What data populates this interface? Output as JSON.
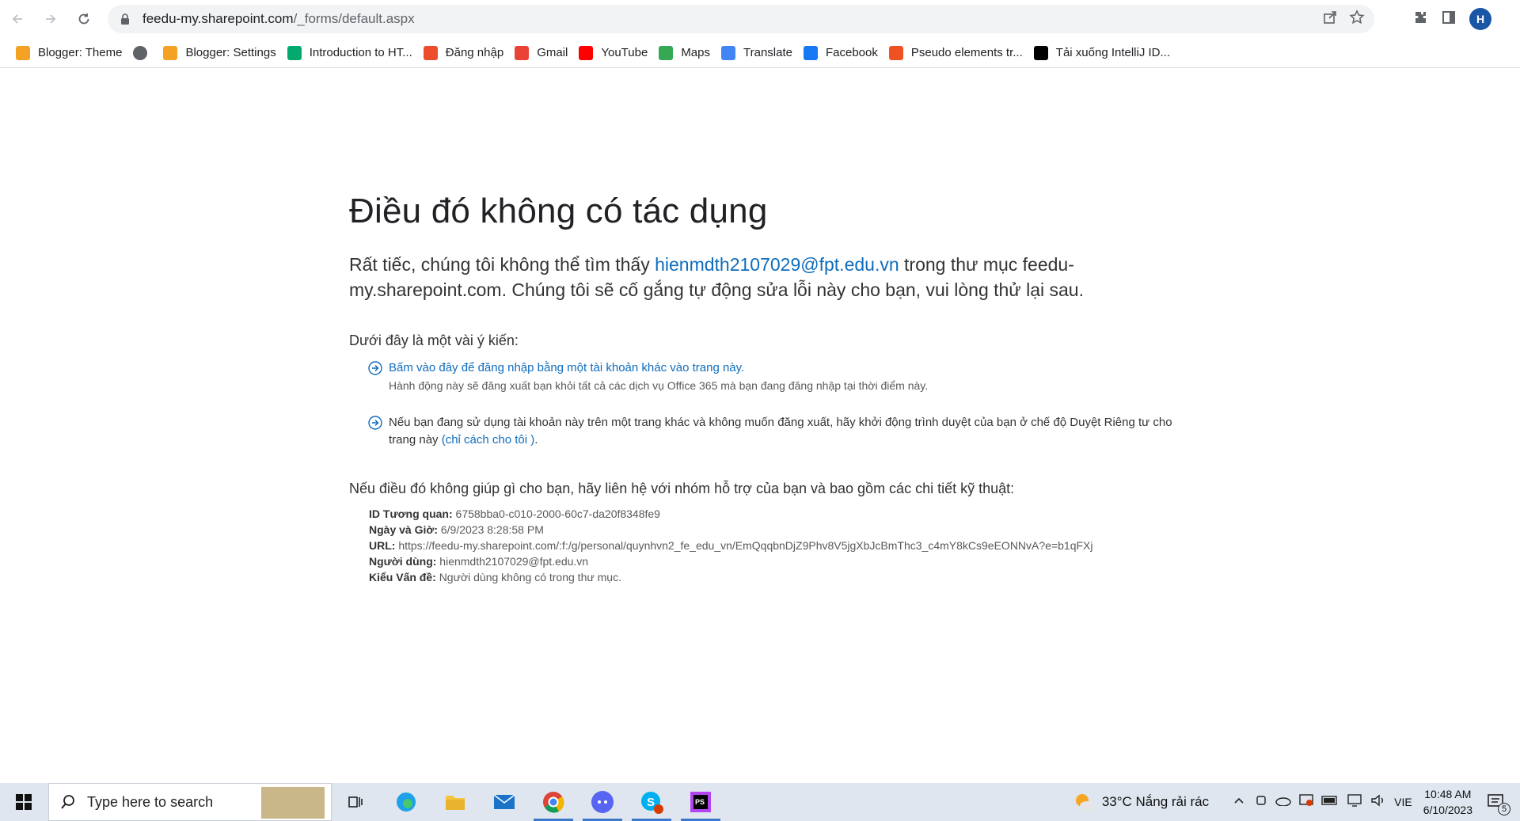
{
  "browser": {
    "url_host": "feedu-my.sharepoint.com",
    "url_path": "/_forms/default.aspx",
    "profile_initial": "H"
  },
  "bookmarks": [
    {
      "label": "Blogger: Theme",
      "icon": "blogger-icon",
      "color": "#f4a223"
    },
    {
      "label": "",
      "icon": "globe-icon",
      "color": "#5f6368"
    },
    {
      "label": "Blogger: Settings",
      "icon": "blogger-icon",
      "color": "#f4a223"
    },
    {
      "label": "Introduction to HT...",
      "icon": "w3schools-icon",
      "color": "#04aa6d"
    },
    {
      "label": "Đăng nhập",
      "icon": "shopee-icon",
      "color": "#ee4d2d"
    },
    {
      "label": "Gmail",
      "icon": "gmail-icon",
      "color": "#ea4335"
    },
    {
      "label": "YouTube",
      "icon": "youtube-icon",
      "color": "#ff0000"
    },
    {
      "label": "Maps",
      "icon": "maps-icon",
      "color": "#34a853"
    },
    {
      "label": "Translate",
      "icon": "translate-icon",
      "color": "#4285f4"
    },
    {
      "label": "Facebook",
      "icon": "facebook-icon",
      "color": "#1877f2"
    },
    {
      "label": "Pseudo elements tr...",
      "icon": "f8-icon",
      "color": "#f05123"
    },
    {
      "label": "Tải xuống IntelliJ ID...",
      "icon": "intellij-icon",
      "color": "#000000"
    }
  ],
  "page": {
    "title": "Điều đó không có tác dụng",
    "lead_before": "Rất tiếc, chúng tôi không thể tìm thấy ",
    "lead_email": "hienmdth2107029@fpt.edu.vn",
    "lead_after": " trong thư mục feedu-my.sharepoint.com. Chúng tôi sẽ cố gắng tự động sửa lỗi này cho bạn, vui lòng thử lại sau.",
    "suggest_heading": "Dưới đây là một vài ý kiến:",
    "suggest1_link": "Bấm vào đây để đăng nhập bằng một tài khoản khác vào trang này.",
    "suggest1_note": "Hành động này sẽ đăng xuất bạn khỏi tất cả các dịch vụ Office 365 mà bạn đang đăng nhập tại thời điểm này.",
    "suggest2_text": "Nếu bạn đang sử dụng tài khoản này trên một trang khác và không muốn đăng xuất, hãy khởi động trình duyệt của bạn ở chế độ Duyệt Riêng tư cho trang này ",
    "suggest2_link": "(chỉ cách cho tôi )",
    "suggest2_end": ".",
    "help_text": "Nếu điều đó không giúp gì cho bạn, hãy liên hệ với nhóm hỗ trợ của bạn và bao gồm các chi tiết kỹ thuật:",
    "details": [
      {
        "key": "ID Tương quan:",
        "value": "6758bba0-c010-2000-60c7-da20f8348fe9"
      },
      {
        "key": "Ngày và Giờ:",
        "value": "6/9/2023 8:28:58 PM"
      },
      {
        "key": "URL:",
        "value": "https://feedu-my.sharepoint.com/:f:/g/personal/quynhvn2_fe_edu_vn/EmQqqbnDjZ9Phv8V5jgXbJcBmThc3_c4mY8kCs9eEONNvA?e=b1qFXj"
      },
      {
        "key": "Người dùng:",
        "value": "hienmdth2107029@fpt.edu.vn"
      },
      {
        "key": "Kiểu Vấn đề:",
        "value": "Người dùng không có trong thư mục."
      }
    ]
  },
  "taskbar": {
    "search_placeholder": "Type here to search",
    "weather": "33°C  Nắng rải rác",
    "lang": "VIE",
    "time": "10:48 AM",
    "date": "6/10/2023",
    "notification_count": "5"
  }
}
